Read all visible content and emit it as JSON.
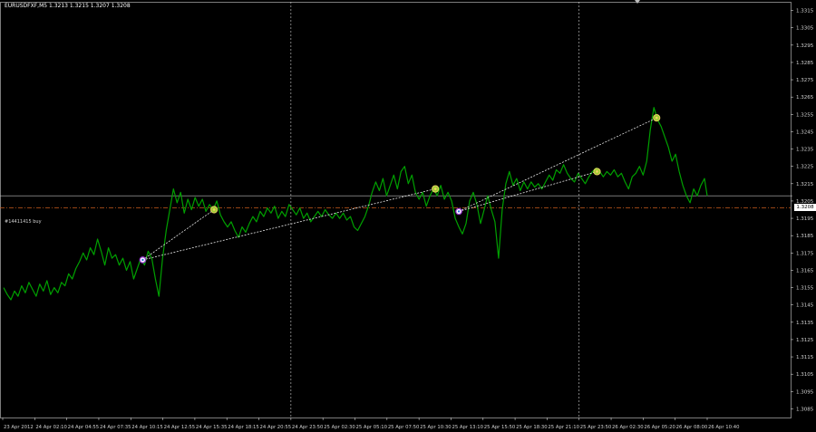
{
  "window": {
    "symbol_title": "EURUSDFXF,M5  1.3213 1.3215 1.3207 1.3208",
    "order_label": "#14411415 buy",
    "current_price": "1.3208"
  },
  "colors": {
    "background": "#000000",
    "price_line": "#00a000",
    "grid": "#cfcfcf",
    "axis_text": "#cfcfcf",
    "order_line": "#c85a1e",
    "bid_line": "#bdbdbd",
    "trade_line": "#e8e8e8"
  },
  "chart_data": {
    "type": "line",
    "y_axis": {
      "ylim": [
        1.308,
        1.332
      ],
      "tick_labels": [
        "1.3315",
        "1.3305",
        "1.3295",
        "1.3285",
        "1.3275",
        "1.3265",
        "1.3255",
        "1.3245",
        "1.3235",
        "1.3225",
        "1.3215",
        "1.3205",
        "1.3195",
        "1.3185",
        "1.3175",
        "1.3165",
        "1.3155",
        "1.3145",
        "1.3135",
        "1.3125",
        "1.3115",
        "1.3105",
        "1.3095",
        "1.3085"
      ]
    },
    "x_axis": {
      "tick_labels": [
        "23 Apr 2012",
        "24 Apr 02:10",
        "24 Apr 04:55",
        "24 Apr 07:35",
        "24 Apr 10:15",
        "24 Apr 12:55",
        "24 Apr 15:35",
        "24 Apr 18:15",
        "24 Apr 20:55",
        "24 Apr 23:50",
        "25 Apr 02:30",
        "25 Apr 05:10",
        "25 Apr 07:50",
        "25 Apr 10:30",
        "25 Apr 13:10",
        "25 Apr 15:50",
        "25 Apr 18:30",
        "25 Apr 21:10",
        "25 Apr 23:50",
        "26 Apr 02:30",
        "26 Apr 05:20",
        "26 Apr 08:00",
        "26 Apr 10:40"
      ]
    },
    "day_separators": [
      "24 Apr 23:50",
      "25 Apr 23:50"
    ],
    "price_series": [
      {
        "x": 0,
        "y": 1.3155
      },
      {
        "x": 4,
        "y": 1.3151
      },
      {
        "x": 8,
        "y": 1.3148
      },
      {
        "x": 12,
        "y": 1.3153
      },
      {
        "x": 16,
        "y": 1.315
      },
      {
        "x": 20,
        "y": 1.3156
      },
      {
        "x": 24,
        "y": 1.3152
      },
      {
        "x": 28,
        "y": 1.3158
      },
      {
        "x": 32,
        "y": 1.3154
      },
      {
        "x": 36,
        "y": 1.315
      },
      {
        "x": 40,
        "y": 1.3157
      },
      {
        "x": 44,
        "y": 1.3153
      },
      {
        "x": 48,
        "y": 1.3159
      },
      {
        "x": 52,
        "y": 1.3151
      },
      {
        "x": 56,
        "y": 1.3155
      },
      {
        "x": 60,
        "y": 1.3152
      },
      {
        "x": 64,
        "y": 1.3158
      },
      {
        "x": 68,
        "y": 1.3156
      },
      {
        "x": 72,
        "y": 1.3163
      },
      {
        "x": 76,
        "y": 1.316
      },
      {
        "x": 80,
        "y": 1.3166
      },
      {
        "x": 84,
        "y": 1.317
      },
      {
        "x": 88,
        "y": 1.3175
      },
      {
        "x": 92,
        "y": 1.3171
      },
      {
        "x": 96,
        "y": 1.3178
      },
      {
        "x": 100,
        "y": 1.3174
      },
      {
        "x": 104,
        "y": 1.3183
      },
      {
        "x": 108,
        "y": 1.3176
      },
      {
        "x": 112,
        "y": 1.3168
      },
      {
        "x": 116,
        "y": 1.3178
      },
      {
        "x": 120,
        "y": 1.3172
      },
      {
        "x": 124,
        "y": 1.3174
      },
      {
        "x": 128,
        "y": 1.3168
      },
      {
        "x": 132,
        "y": 1.3172
      },
      {
        "x": 136,
        "y": 1.3165
      },
      {
        "x": 140,
        "y": 1.317
      },
      {
        "x": 144,
        "y": 1.316
      },
      {
        "x": 148,
        "y": 1.3166
      },
      {
        "x": 152,
        "y": 1.3172
      },
      {
        "x": 156,
        "y": 1.3168
      },
      {
        "x": 160,
        "y": 1.3176
      },
      {
        "x": 164,
        "y": 1.3172
      },
      {
        "x": 168,
        "y": 1.316
      },
      {
        "x": 172,
        "y": 1.315
      },
      {
        "x": 176,
        "y": 1.3172
      },
      {
        "x": 180,
        "y": 1.3188
      },
      {
        "x": 184,
        "y": 1.32
      },
      {
        "x": 188,
        "y": 1.3212
      },
      {
        "x": 192,
        "y": 1.3204
      },
      {
        "x": 196,
        "y": 1.321
      },
      {
        "x": 200,
        "y": 1.3198
      },
      {
        "x": 204,
        "y": 1.3206
      },
      {
        "x": 208,
        "y": 1.32
      },
      {
        "x": 212,
        "y": 1.3207
      },
      {
        "x": 216,
        "y": 1.3202
      },
      {
        "x": 220,
        "y": 1.3206
      },
      {
        "x": 224,
        "y": 1.3199
      },
      {
        "x": 228,
        "y": 1.3203
      },
      {
        "x": 232,
        "y": 1.32
      },
      {
        "x": 236,
        "y": 1.3205
      },
      {
        "x": 240,
        "y": 1.3197
      },
      {
        "x": 244,
        "y": 1.3193
      },
      {
        "x": 248,
        "y": 1.319
      },
      {
        "x": 252,
        "y": 1.3193
      },
      {
        "x": 256,
        "y": 1.3188
      },
      {
        "x": 260,
        "y": 1.3184
      },
      {
        "x": 264,
        "y": 1.319
      },
      {
        "x": 268,
        "y": 1.3187
      },
      {
        "x": 272,
        "y": 1.3192
      },
      {
        "x": 276,
        "y": 1.3196
      },
      {
        "x": 280,
        "y": 1.3193
      },
      {
        "x": 284,
        "y": 1.3199
      },
      {
        "x": 288,
        "y": 1.3196
      },
      {
        "x": 292,
        "y": 1.3201
      },
      {
        "x": 296,
        "y": 1.3198
      },
      {
        "x": 300,
        "y": 1.3202
      },
      {
        "x": 304,
        "y": 1.3195
      },
      {
        "x": 308,
        "y": 1.3199
      },
      {
        "x": 312,
        "y": 1.3196
      },
      {
        "x": 316,
        "y": 1.3203
      },
      {
        "x": 320,
        "y": 1.32
      },
      {
        "x": 324,
        "y": 1.3197
      },
      {
        "x": 328,
        "y": 1.3201
      },
      {
        "x": 332,
        "y": 1.3195
      },
      {
        "x": 336,
        "y": 1.3198
      },
      {
        "x": 340,
        "y": 1.3193
      },
      {
        "x": 344,
        "y": 1.3196
      },
      {
        "x": 348,
        "y": 1.3199
      },
      {
        "x": 352,
        "y": 1.3196
      },
      {
        "x": 356,
        "y": 1.32
      },
      {
        "x": 360,
        "y": 1.3197
      },
      {
        "x": 364,
        "y": 1.3195
      },
      {
        "x": 368,
        "y": 1.3198
      },
      {
        "x": 372,
        "y": 1.3195
      },
      {
        "x": 376,
        "y": 1.3198
      },
      {
        "x": 380,
        "y": 1.3194
      },
      {
        "x": 384,
        "y": 1.3196
      },
      {
        "x": 388,
        "y": 1.319
      },
      {
        "x": 392,
        "y": 1.3188
      },
      {
        "x": 396,
        "y": 1.3192
      },
      {
        "x": 400,
        "y": 1.3196
      },
      {
        "x": 404,
        "y": 1.3202
      },
      {
        "x": 408,
        "y": 1.321
      },
      {
        "x": 412,
        "y": 1.3216
      },
      {
        "x": 416,
        "y": 1.3211
      },
      {
        "x": 420,
        "y": 1.3218
      },
      {
        "x": 424,
        "y": 1.3208
      },
      {
        "x": 428,
        "y": 1.3214
      },
      {
        "x": 432,
        "y": 1.322
      },
      {
        "x": 436,
        "y": 1.3212
      },
      {
        "x": 440,
        "y": 1.3222
      },
      {
        "x": 444,
        "y": 1.3225
      },
      {
        "x": 448,
        "y": 1.3215
      },
      {
        "x": 452,
        "y": 1.322
      },
      {
        "x": 456,
        "y": 1.321
      },
      {
        "x": 460,
        "y": 1.3206
      },
      {
        "x": 464,
        "y": 1.321
      },
      {
        "x": 468,
        "y": 1.3202
      },
      {
        "x": 472,
        "y": 1.3208
      },
      {
        "x": 476,
        "y": 1.3212
      },
      {
        "x": 480,
        "y": 1.3208
      },
      {
        "x": 484,
        "y": 1.3214
      },
      {
        "x": 488,
        "y": 1.3206
      },
      {
        "x": 492,
        "y": 1.321
      },
      {
        "x": 496,
        "y": 1.3205
      },
      {
        "x": 500,
        "y": 1.3195
      },
      {
        "x": 504,
        "y": 1.319
      },
      {
        "x": 508,
        "y": 1.3186
      },
      {
        "x": 512,
        "y": 1.3192
      },
      {
        "x": 516,
        "y": 1.3205
      },
      {
        "x": 520,
        "y": 1.321
      },
      {
        "x": 524,
        "y": 1.3203
      },
      {
        "x": 528,
        "y": 1.3192
      },
      {
        "x": 532,
        "y": 1.32
      },
      {
        "x": 536,
        "y": 1.3208
      },
      {
        "x": 540,
        "y": 1.32
      },
      {
        "x": 544,
        "y": 1.3193
      },
      {
        "x": 548,
        "y": 1.3172
      },
      {
        "x": 552,
        "y": 1.32
      },
      {
        "x": 556,
        "y": 1.3215
      },
      {
        "x": 560,
        "y": 1.3222
      },
      {
        "x": 564,
        "y": 1.3214
      },
      {
        "x": 568,
        "y": 1.3218
      },
      {
        "x": 572,
        "y": 1.3211
      },
      {
        "x": 576,
        "y": 1.3216
      },
      {
        "x": 580,
        "y": 1.3212
      },
      {
        "x": 584,
        "y": 1.3216
      },
      {
        "x": 588,
        "y": 1.3213
      },
      {
        "x": 592,
        "y": 1.3215
      },
      {
        "x": 596,
        "y": 1.3212
      },
      {
        "x": 600,
        "y": 1.3216
      },
      {
        "x": 604,
        "y": 1.322
      },
      {
        "x": 608,
        "y": 1.3217
      },
      {
        "x": 612,
        "y": 1.3223
      },
      {
        "x": 616,
        "y": 1.3221
      },
      {
        "x": 620,
        "y": 1.3226
      },
      {
        "x": 624,
        "y": 1.3221
      },
      {
        "x": 628,
        "y": 1.3218
      },
      {
        "x": 632,
        "y": 1.3216
      },
      {
        "x": 636,
        "y": 1.3221
      },
      {
        "x": 640,
        "y": 1.3218
      },
      {
        "x": 644,
        "y": 1.3215
      },
      {
        "x": 648,
        "y": 1.3219
      },
      {
        "x": 652,
        "y": 1.3222
      },
      {
        "x": 656,
        "y": 1.3224
      },
      {
        "x": 660,
        "y": 1.3222
      },
      {
        "x": 664,
        "y": 1.3219
      },
      {
        "x": 668,
        "y": 1.3222
      },
      {
        "x": 672,
        "y": 1.322
      },
      {
        "x": 676,
        "y": 1.3223
      },
      {
        "x": 680,
        "y": 1.3219
      },
      {
        "x": 684,
        "y": 1.3221
      },
      {
        "x": 688,
        "y": 1.3216
      },
      {
        "x": 692,
        "y": 1.3212
      },
      {
        "x": 696,
        "y": 1.3219
      },
      {
        "x": 700,
        "y": 1.3221
      },
      {
        "x": 704,
        "y": 1.3225
      },
      {
        "x": 708,
        "y": 1.322
      },
      {
        "x": 712,
        "y": 1.3228
      },
      {
        "x": 716,
        "y": 1.3246
      },
      {
        "x": 720,
        "y": 1.3259
      },
      {
        "x": 724,
        "y": 1.3252
      },
      {
        "x": 728,
        "y": 1.3248
      },
      {
        "x": 732,
        "y": 1.3242
      },
      {
        "x": 736,
        "y": 1.3236
      },
      {
        "x": 740,
        "y": 1.3228
      },
      {
        "x": 744,
        "y": 1.3232
      },
      {
        "x": 748,
        "y": 1.3222
      },
      {
        "x": 752,
        "y": 1.3214
      },
      {
        "x": 756,
        "y": 1.3208
      },
      {
        "x": 760,
        "y": 1.3204
      },
      {
        "x": 764,
        "y": 1.3212
      },
      {
        "x": 768,
        "y": 1.3208
      },
      {
        "x": 772,
        "y": 1.3214
      },
      {
        "x": 776,
        "y": 1.3218
      },
      {
        "x": 779,
        "y": 1.3208
      }
    ],
    "trade_markers": [
      {
        "x": 154,
        "y": 1.3171,
        "side": "entry"
      },
      {
        "x": 233,
        "y": 1.32,
        "side": "exit"
      },
      {
        "x": 478,
        "y": 1.3212,
        "side": "exit"
      },
      {
        "x": 504,
        "y": 1.3199,
        "side": "entry"
      },
      {
        "x": 657,
        "y": 1.3222,
        "side": "exit"
      },
      {
        "x": 723,
        "y": 1.3253,
        "side": "exit"
      }
    ],
    "trade_links": [
      [
        0,
        1
      ],
      [
        0,
        2
      ],
      [
        3,
        4
      ],
      [
        3,
        5
      ]
    ],
    "horizontal_lines": [
      {
        "kind": "bid",
        "price": 1.3208
      },
      {
        "kind": "order",
        "price": 1.3201
      }
    ]
  }
}
